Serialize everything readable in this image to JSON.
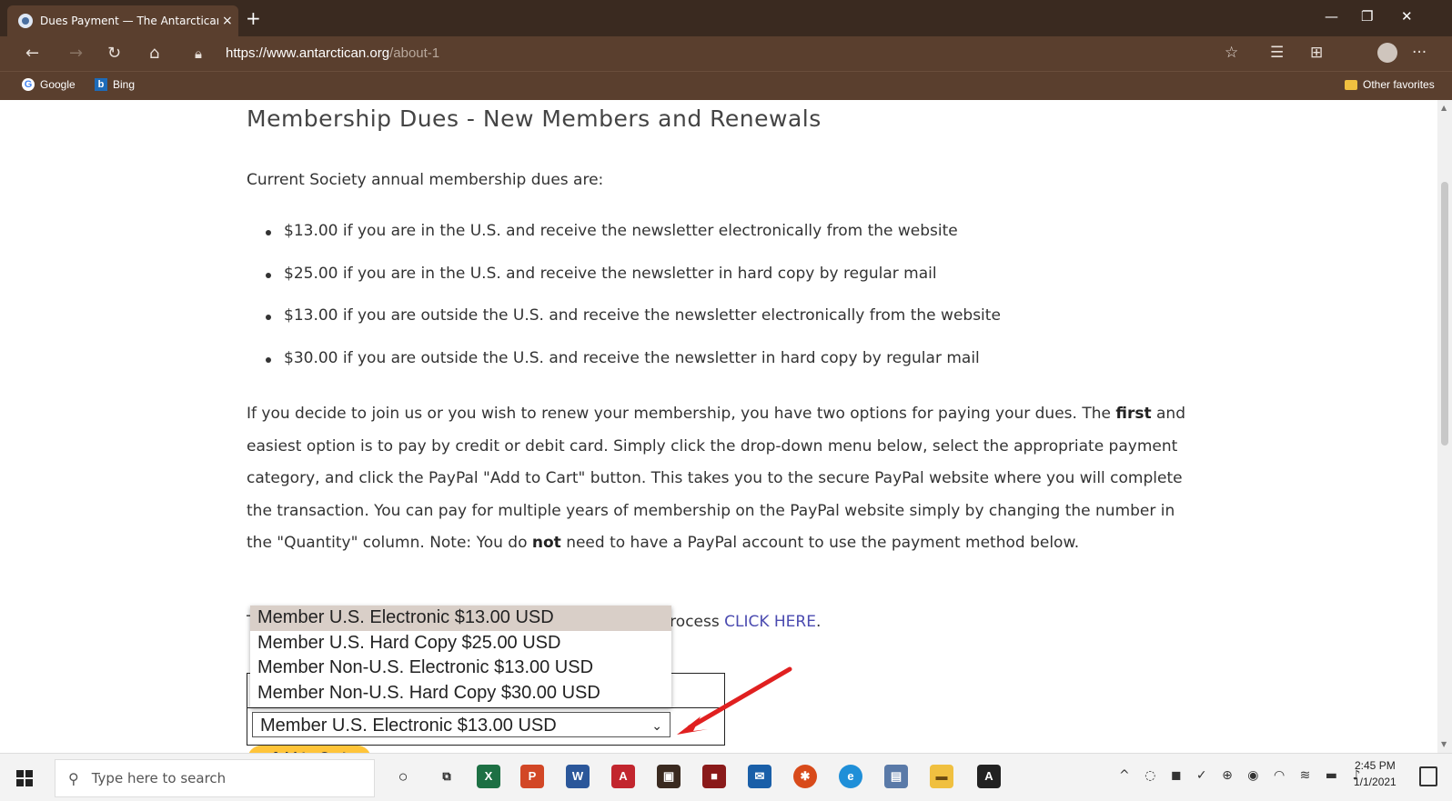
{
  "browser": {
    "tab_title": "Dues Payment — The Antarctican Society",
    "tab_close": "×",
    "new_tab": "+",
    "url_domain": "https://www.antarctican.org",
    "url_path": "/about-1",
    "favorites": [
      {
        "label": "Google",
        "icon": "google-icon"
      },
      {
        "label": "Bing",
        "icon": "bing-icon"
      }
    ],
    "other_favorites": "Other favorites",
    "more": "···"
  },
  "page": {
    "heading": "Membership Dues - New Members and Renewals",
    "intro": "Current Society annual membership dues are:",
    "dues": [
      "$13.00 if you are in the U.S. and receive the newsletter electronically from the website",
      "$25.00 if you are in the U.S. and receive the newsletter in hard copy by regular mail",
      "$13.00 if you are outside the U.S. and receive the newsletter electronically from the website",
      "$30.00 if you are outside the U.S. and receive the newsletter in hard copy by regular mail"
    ],
    "paragraph": {
      "p1": "If you decide to join us or you wish to renew your membership, you have two options for paying your dues. The ",
      "bold1": "first",
      "p2": " and easiest option is to pay by credit or debit card. Simply click the drop-down menu below, select the appropriate payment category, and click the PayPal \"Add to Cart\" button. This takes you to the secure PayPal website where you will complete the transaction. You can pay for multiple years of membership on the PayPal website simply by changing the number in the \"Quantity\" column. Note: You do ",
      "bold2": "not",
      "p3": " need to have a PayPal account to use the payment method below."
    },
    "tline_prefix": "T",
    "tline_suffix": "process ",
    "tline_link": "CLICK HERE",
    "tline_end": ".",
    "dropdown_options": [
      "Member U.S. Electronic $13.00 USD",
      "Member U.S. Hard Copy $25.00 USD",
      "Member Non-U.S. Electronic $13.00 USD",
      "Member Non-U.S. Hard Copy $30.00 USD"
    ],
    "selected_option": "Member U.S. Electronic $13.00 USD",
    "add_to_cart": "Add to Cart"
  },
  "taskbar": {
    "search_placeholder": "Type here to search",
    "time": "2:45 PM",
    "date": "1/1/2021"
  },
  "colors": {
    "accent": "#5a3f2e",
    "arrow": "#e02020",
    "paypal": "#ffc439"
  }
}
